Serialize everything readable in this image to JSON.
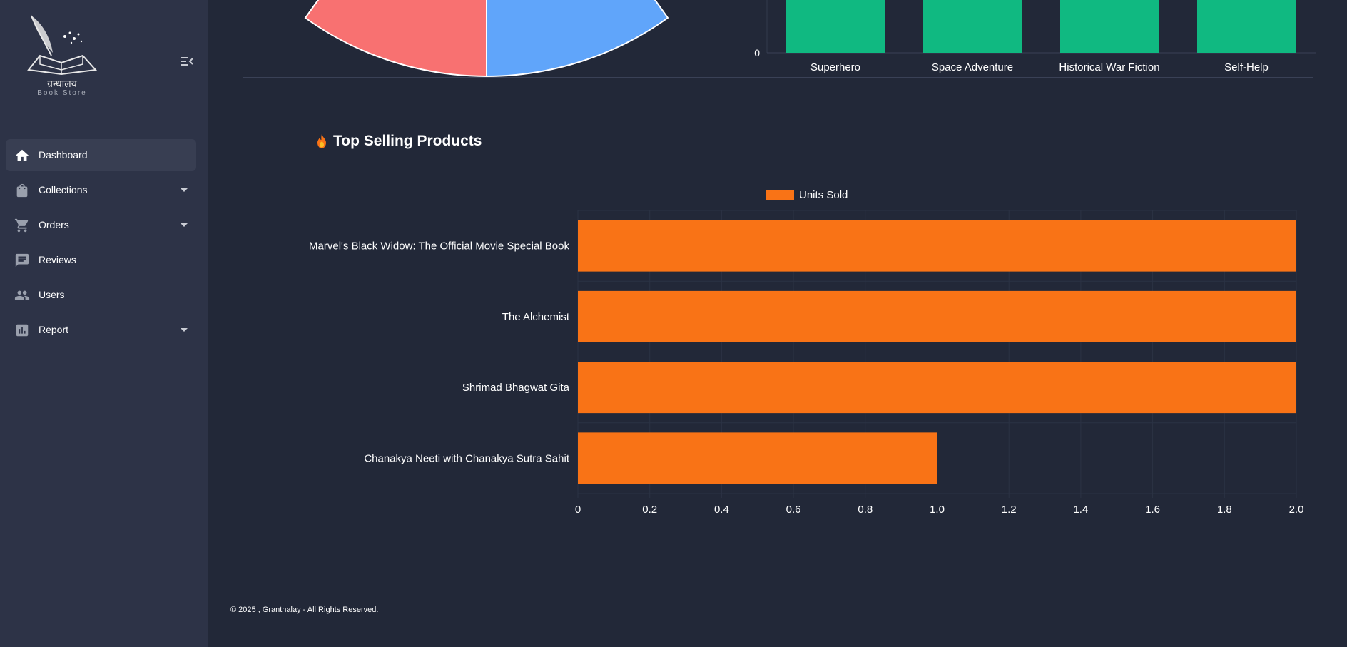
{
  "brand": {
    "title": "ग्रन्थालय",
    "subtitle": "Book Store"
  },
  "sidebar": {
    "items": [
      {
        "label": "Dashboard",
        "icon": "home-icon",
        "active": true,
        "has_submenu": false
      },
      {
        "label": "Collections",
        "icon": "shopping-bag-icon",
        "active": false,
        "has_submenu": true
      },
      {
        "label": "Orders",
        "icon": "cart-icon",
        "active": false,
        "has_submenu": true
      },
      {
        "label": "Reviews",
        "icon": "review-icon",
        "active": false,
        "has_submenu": false
      },
      {
        "label": "Users",
        "icon": "users-icon",
        "active": false,
        "has_submenu": false
      },
      {
        "label": "Report",
        "icon": "report-icon",
        "active": false,
        "has_submenu": true
      }
    ]
  },
  "top_section": {
    "pie_colors": [
      "#f87171",
      "#60a5fa"
    ],
    "bar_categories": [
      "Superhero",
      "Space Adventure",
      "Historical War Fiction",
      "Self-Help"
    ],
    "bar_zero_label": "0",
    "bar_color": "#10b981"
  },
  "top_selling": {
    "title": "Top Selling Products",
    "icon": "fire-icon"
  },
  "chart_data": {
    "type": "bar",
    "orientation": "horizontal",
    "categories": [
      "Marvel's Black Widow: The Official Movie Special Book",
      "The Alchemist",
      "Shrimad Bhagwat Gita",
      "Chanakya Neeti with Chanakya Sutra Sahit"
    ],
    "series": [
      {
        "name": "Units Sold",
        "values": [
          2,
          2,
          2,
          1
        ],
        "color": "#f97316"
      }
    ],
    "xlim": [
      0,
      2.0
    ],
    "xticks": [
      "0",
      "0.2",
      "0.4",
      "0.6",
      "0.8",
      "1.0",
      "1.2",
      "1.4",
      "1.6",
      "1.8",
      "2.0"
    ],
    "grid": true,
    "legend": "top-center"
  },
  "footer": {
    "text": "© 2025 , Granthalay - All Rights Reserved."
  }
}
